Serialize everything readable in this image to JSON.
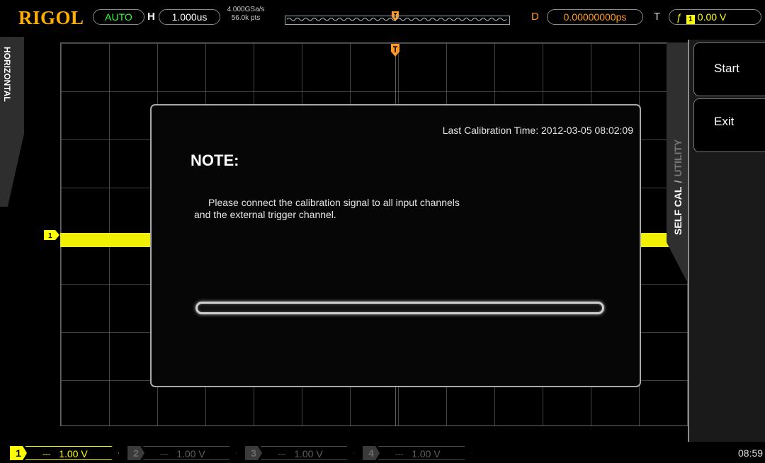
{
  "brand": "RIGOL",
  "topbar": {
    "run_mode": "AUTO",
    "horizontal_label": "H",
    "timebase": "1.000us",
    "sample_rate": "4.000GSa/s",
    "memory_depth": "56.0k pts",
    "delay_label": "D",
    "delay_value": "0.00000000ps",
    "trigger_label": "T",
    "trigger_slope": "ƒ",
    "trigger_source": "1",
    "trigger_level": "0.00 V"
  },
  "left_tab": {
    "label": "HORIZONTAL"
  },
  "channel_marker": "1",
  "dialog": {
    "last_calibration": "Last Calibration Time: 2012-03-05 08:02:09",
    "title": "NOTE:",
    "message_line1": "Please connect the calibration signal to all input channels",
    "message_line2": "and the external trigger channel.",
    "progress_percent": 0
  },
  "menu": {
    "tab_inactive": "UTILITY",
    "tab_separator": "/",
    "tab_active": "SELF CAL",
    "start_label": "Start",
    "exit_label": "Exit"
  },
  "bottombar": {
    "channels": [
      {
        "number": "1",
        "coupling": "⎓",
        "scale": "1.00 V"
      },
      {
        "number": "2",
        "coupling": "⎓",
        "scale": "1.00 V"
      },
      {
        "number": "3",
        "coupling": "⎓",
        "scale": "1.00 V"
      },
      {
        "number": "4",
        "coupling": "⎓",
        "scale": "1.00 V"
      }
    ],
    "clock": "08:59"
  },
  "colors": {
    "brand": "#ffb000",
    "channel1": "#ffff00",
    "trigger": "#ff9a20",
    "auto": "#39ff39"
  }
}
